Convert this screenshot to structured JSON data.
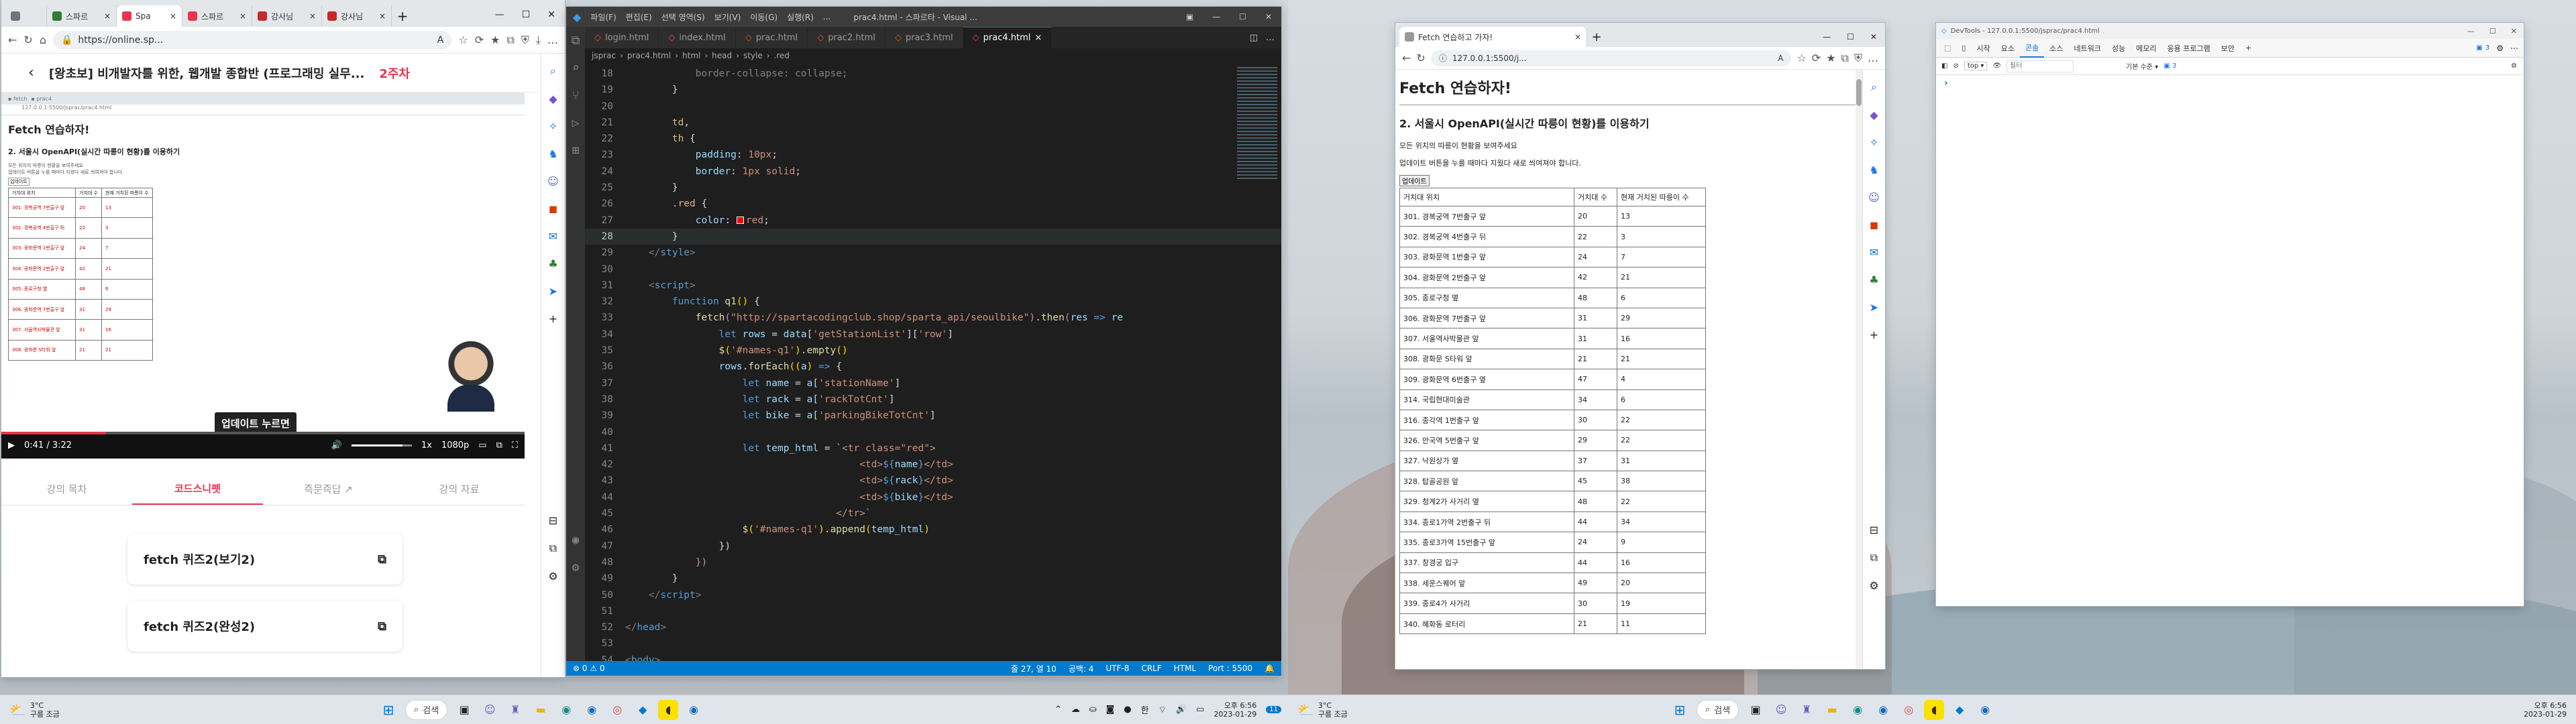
{
  "left_browser": {
    "tabs": [
      {
        "label": "",
        "color": "#6c757d"
      },
      {
        "label": "스파르",
        "color": "#2e7d32"
      },
      {
        "label": "Spa",
        "color": "#e8344e"
      },
      {
        "label": "스파르",
        "color": "#e8344e"
      },
      {
        "label": "강사님",
        "color": "#c62828"
      },
      {
        "label": "강사님",
        "color": "#c62828"
      }
    ],
    "new_tab": "+",
    "url": "https://online.sp...",
    "course_title": "[왕초보] 비개발자를 위한, 웹개발 종합반 (프로그래밍 실무...",
    "week_badge": "2주차",
    "embedded": {
      "heading": "Fetch 연습하자!",
      "subheading": "2. 서울시 OpenAPI(실시간 따릉이 현황)를 이용하기",
      "line1": "모든 위치의 따릉이 현황을 보여주세요",
      "line2": "업데이트 버튼을 누를 때마다 지웠다 새로 씌여져야 합니다.",
      "button": "업데이트",
      "headers": [
        "거치대 위치",
        "거치대 수",
        "현재 거치된 따릉이 수"
      ]
    },
    "video": {
      "tooltip": "업데이트 누르면",
      "time": "0:41 / 3:22",
      "speed": "1x",
      "quality": "1080p"
    },
    "course_tabs": [
      "강의 목차",
      "코드스니펫",
      "즉문즉답 ↗",
      "강의 자료"
    ],
    "snippets": [
      "fetch 퀴즈2(보기2)",
      "fetch 퀴즈2(완성2)"
    ]
  },
  "vscode": {
    "menu": [
      "파일(F)",
      "편집(E)",
      "선택 영역(S)",
      "보기(V)",
      "이동(G)",
      "실행(R)",
      "..."
    ],
    "title": "prac4.html - 스파르타 - Visual ...",
    "tabs": [
      "login.html",
      "index.html",
      "prac.html",
      "prac2.html",
      "prac3.html",
      "prac4.html"
    ],
    "breadcrumb": [
      "jsprac",
      "prac4.html",
      "html",
      "head",
      "style",
      ".red"
    ],
    "status": {
      "left": "⊗ 0 ⚠ 0",
      "position": "줄 27, 열 10",
      "spaces": "공백: 4",
      "encoding": "UTF-8",
      "eol": "CRLF",
      "language": "HTML",
      "port": "Port : 5500"
    }
  },
  "right_browser": {
    "tab_title": "Fetch 연습하고 가자!",
    "url": "127.0.0.1:5500/j...",
    "heading": "Fetch 연습하자!",
    "subheading": "2. 서울시 OpenAPI(실시간 따릉이 현황)를 이용하기",
    "line1": "모든 위치의 따릉이 현황을 보여주세요",
    "line2": "업데이트 버튼을 누를 때마다 지웠다 새로 씌여져야 합니다.",
    "button": "업데이트",
    "headers": [
      "거치대 위치",
      "거치대 수",
      "현재 거치된 따릉이 수"
    ],
    "rows": [
      [
        "301. 경복궁역 7번출구 앞",
        "20",
        "13"
      ],
      [
        "302. 경복궁역 4번출구 뒤",
        "22",
        "3"
      ],
      [
        "303. 광화문역 1번출구 앞",
        "24",
        "7"
      ],
      [
        "304. 광화문역 2번출구 앞",
        "42",
        "21"
      ],
      [
        "305. 종로구청 옆",
        "48",
        "6"
      ],
      [
        "306. 광화문역 7번출구 앞",
        "31",
        "29"
      ],
      [
        "307. 서울역사박물관 앞",
        "31",
        "16"
      ],
      [
        "308. 광화문 S타워 앞",
        "21",
        "21"
      ],
      [
        "309. 광화문역 6번출구 옆",
        "47",
        "4"
      ],
      [
        "314. 국립현대미술관",
        "34",
        "6"
      ],
      [
        "316. 종각역 1번출구 앞",
        "30",
        "22"
      ],
      [
        "326. 안국역 5번출구 앞",
        "29",
        "22"
      ],
      [
        "327. 낙원상가 옆",
        "37",
        "31"
      ],
      [
        "328. 탑골공원 앞",
        "45",
        "38"
      ],
      [
        "329. 청계2가 사거리 옆",
        "48",
        "22"
      ],
      [
        "334. 종로1가역 2번출구 뒤",
        "44",
        "34"
      ],
      [
        "335. 종로3가역 15번출구 앞",
        "24",
        "9"
      ],
      [
        "337. 창경궁 입구",
        "44",
        "16"
      ],
      [
        "338. 세운스퀘어 앞",
        "49",
        "20"
      ],
      [
        "339. 종로4가 사거리",
        "30",
        "19"
      ],
      [
        "340. 혜화동 로터리",
        "21",
        "11"
      ]
    ]
  },
  "devtools": {
    "title": "DevTools - 127.0.0.1:5500/jsprac/prac4.html",
    "tabs": [
      "시작",
      "요소",
      "콘솔",
      "소스",
      "네트워크",
      "성능",
      "메모리",
      "응용 프로그램",
      "보안"
    ],
    "issues": "3",
    "context": "top",
    "filter_placeholder": "필터",
    "level": "기본 수준",
    "level_count": "3",
    "prompt": "›"
  },
  "taskbar_left": {
    "weather_temp": "3°C",
    "weather_desc": "구름 조금",
    "search": "검색",
    "time": "오후 6:56",
    "date": "2023-01-29",
    "lang": "한",
    "notif": "11"
  },
  "taskbar_right": {
    "weather_temp": "3°C",
    "weather_desc": "구름 조금",
    "search": "검색",
    "time": "오후 6:56",
    "date": "2023-01-29"
  }
}
